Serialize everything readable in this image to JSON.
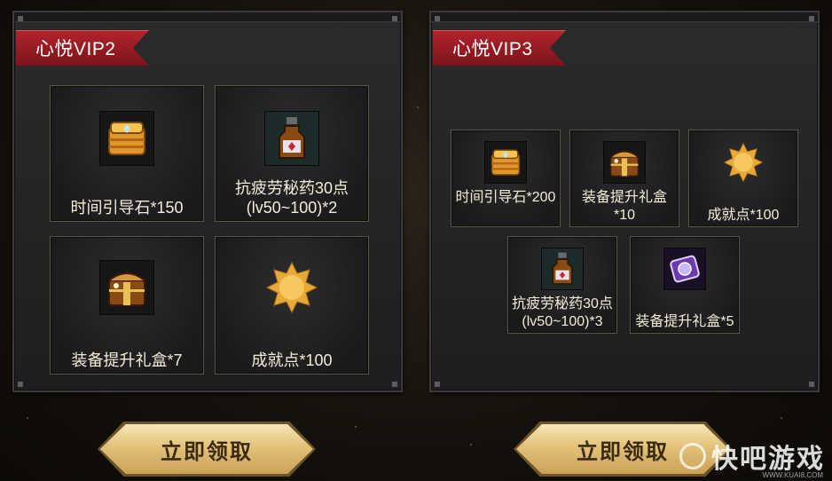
{
  "panels": [
    {
      "title": "心悦VIP2",
      "items": [
        {
          "label": "时间引导石*150",
          "icon": "gold-chest-icon"
        },
        {
          "label": "抗疲劳秘药30点(lv50~100)*2",
          "icon": "potion-bottle-icon"
        },
        {
          "label": "装备提升礼盒*7",
          "icon": "treasure-box-icon"
        },
        {
          "label": "成就点*100",
          "icon": "gold-star-icon"
        }
      ],
      "claim_label": "立即领取"
    },
    {
      "title": "心悦VIP3",
      "items": [
        {
          "label": "时间引导石*200",
          "icon": "gold-chest-icon"
        },
        {
          "label": "装备提升礼盒*10",
          "icon": "treasure-box-icon"
        },
        {
          "label": "成就点*100",
          "icon": "gold-star-icon"
        },
        {
          "label": "抗疲劳秘药30点(lv50~100)*3",
          "icon": "potion-bottle-icon"
        },
        {
          "label": "装备提升礼盒*5",
          "icon": "purple-gem-box-icon"
        }
      ],
      "claim_label": "立即领取"
    }
  ],
  "colors": {
    "ribbon": "#b3242d",
    "gold": "#e3c27a"
  },
  "watermark": {
    "text": "快吧游戏",
    "url": "WWW.KUAI8.COM"
  }
}
